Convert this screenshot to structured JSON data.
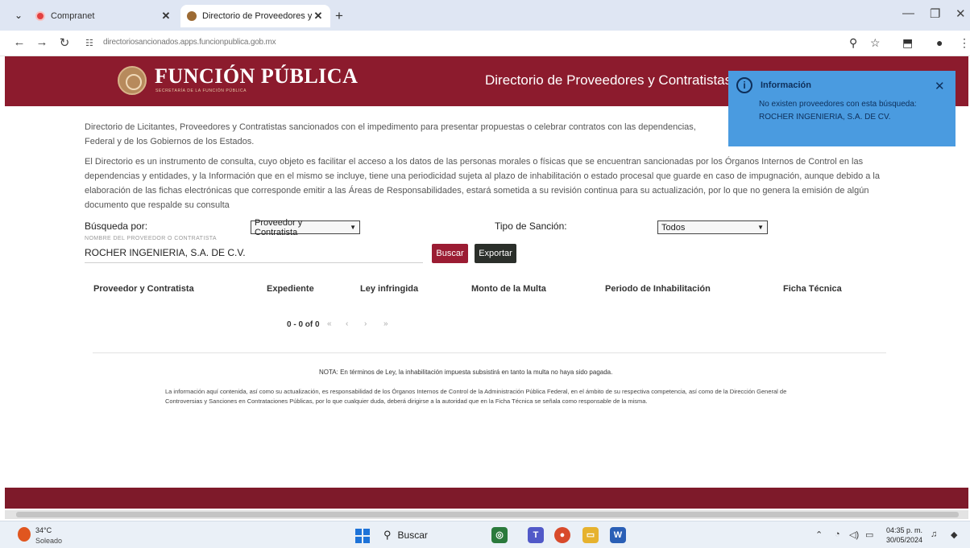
{
  "browser": {
    "tabs": [
      {
        "label": "Compranet",
        "close": "✕"
      },
      {
        "label": "Directorio de Proveedores y Co",
        "close": "✕"
      }
    ],
    "url": "directoriosancionados.apps.funcionpublica.gob.mx"
  },
  "header": {
    "brand": "FUNCIÓN PÚBLICA",
    "brand_sub": "SECRETARÍA DE LA FUNCIÓN PÚBLICA",
    "title": "Directorio de Proveedores y Contratistas"
  },
  "toast": {
    "title": "Información",
    "message": "No existen proveedores con esta búsqueda: ROCHER INGENIERIA, S.A. DE CV."
  },
  "intro": {
    "p1": "Directorio de Licitantes, Proveedores y Contratistas sancionados con el impedimento para presentar propuestas o celebrar contratos con las dependencias, Federal y de los Gobiernos de los Estados.",
    "p2": "El Directorio es un instrumento de consulta, cuyo objeto es facilitar el acceso a los datos de las personas morales o físicas que se encuentran sancionadas por los Órganos Internos de Control en las dependencias y entidades, y la Información que en el mismo se incluye, tiene una periodicidad sujeta al plazo de inhabilitación o estado procesal que guarde en caso de impugnación, aunque debido a la elaboración de las fichas electrónicas que corresponde emitir a las Áreas de Responsabilidades, estará sometida a su revisión continua para su actualización, por lo que no genera la emisión de algún documento que respalde su consulta"
  },
  "search": {
    "by_label": "Búsqueda por:",
    "by_value": "Proveedor y Contratista",
    "type_label": "Tipo de Sanción:",
    "type_value": "Todos",
    "hint": "NOMBRE DEL PROVEEDOR O CONTRATISTA",
    "query": "ROCHER INGENIERIA, S.A. DE C.V.",
    "buscar": "Buscar",
    "exportar": "Exportar"
  },
  "table": {
    "columns": [
      "Proveedor y Contratista",
      "Expediente",
      "Ley infringida",
      "Monto de la Multa",
      "Periodo de Inhabilitación",
      "Ficha Técnica"
    ],
    "pager": "0 - 0 of 0"
  },
  "note": "NOTA: En términos de Ley, la inhabilitación impuesta subsistirá en tanto la multa no haya sido pagada.",
  "disclaimer": "La información aquí contenida, así como su actualización, es responsabilidad de los Órganos Internos de Control de la Administración Pública Federal, en el ámbito de su respectiva competencia, así como de la Dirección General de Controversias y Sanciones en Contrataciones Públicas, por lo que cualquier duda, deberá dirigirse a la autoridad que en la Ficha Técnica se señala como responsable de la misma.",
  "taskbar": {
    "temp": "34°C",
    "weather": "Soleado",
    "search": "Buscar",
    "time": "04:35 p. m.",
    "date": "30/05/2024"
  }
}
